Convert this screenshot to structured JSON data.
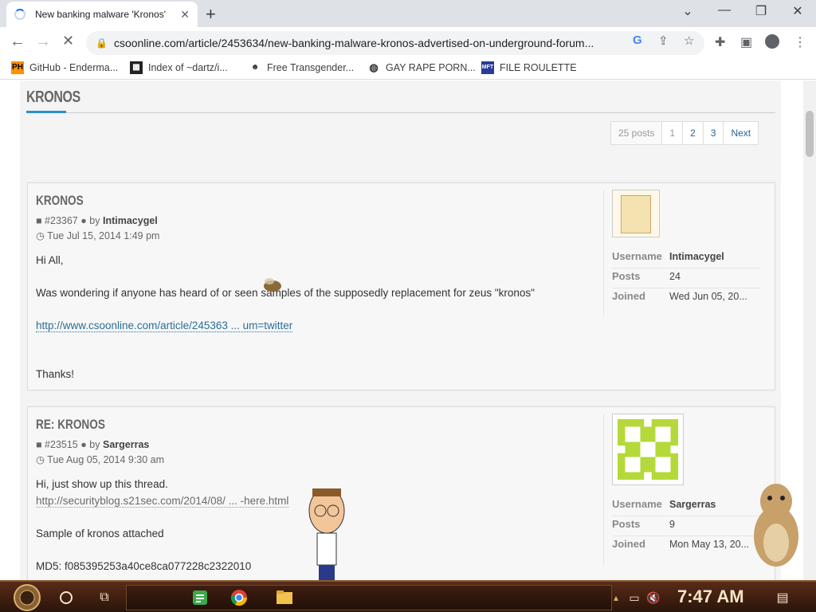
{
  "browser": {
    "tab_title": "New banking malware 'Kronos'",
    "url": "csoonline.com/article/2453634/new-banking-malware-kronos-advertised-on-underground-forum...",
    "bookmarks": [
      {
        "label": "GitHub - Enderma...",
        "icon": "PH"
      },
      {
        "label": "Index of ~dartz/i...",
        "icon": "qr"
      },
      {
        "label": "Free Transgender...",
        "icon": "mask"
      },
      {
        "label": "GAY RAPE PORN...",
        "icon": "globe"
      },
      {
        "label": "FILE ROULETTE",
        "icon": "mft"
      }
    ]
  },
  "forum": {
    "title": "KRONOS",
    "pagination": {
      "count": "25 posts",
      "pages": [
        "1",
        "2",
        "3"
      ],
      "next": "Next"
    }
  },
  "posts": [
    {
      "title": "KRONOS",
      "id": "#23367",
      "by": "by",
      "author": "Intimacygel",
      "date": "Tue Jul 15, 2014 1:49 pm",
      "body": [
        "Hi All,",
        "Was wondering if anyone has heard of or seen samples of the supposedly replacement for zeus \"kronos\"",
        "http://www.csoonline.com/article/245363 ... um=twitter",
        "Thanks!"
      ],
      "profile": {
        "username_label": "Username",
        "username": "Intimacygel",
        "posts_label": "Posts",
        "posts": "24",
        "joined_label": "Joined",
        "joined": "Wed Jun 05, 20..."
      }
    },
    {
      "title": "RE: KRONOS",
      "id": "#23515",
      "by": "by",
      "author": "Sargerras",
      "date": "Tue Aug 05, 2014 9:30 am",
      "body": [
        "Hi, just show up this thread.",
        "http://securityblog.s21sec.com/2014/08/ ... -here.html",
        "Sample of kronos attached",
        "MD5: f085395253a40ce8ca077228c2322010"
      ],
      "profile": {
        "username_label": "Username",
        "username": "Sargerras",
        "posts_label": "Posts",
        "posts": "9",
        "joined_label": "Joined",
        "joined": "Mon May 13, 20..."
      }
    }
  ],
  "taskbar": {
    "clock": "7:47 AM"
  },
  "colors": {
    "accent": "#2a8fce",
    "link": "#2a6f97",
    "taskbar": "#3a1c0e"
  }
}
